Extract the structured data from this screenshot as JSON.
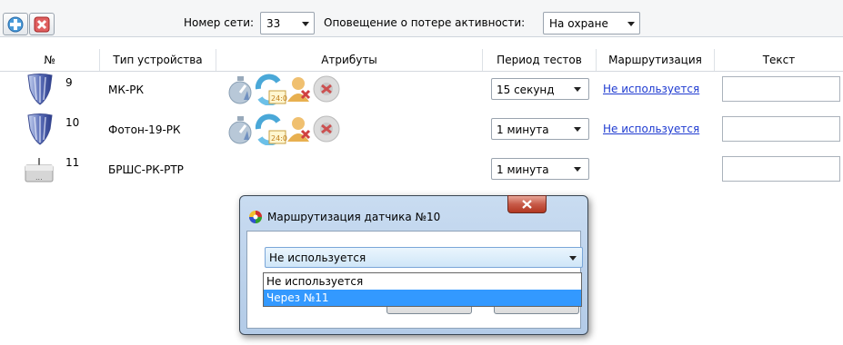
{
  "toolbar": {
    "network_label": "Номер сети:",
    "network_value": "33",
    "alert_label": "Оповещение о потере активности:",
    "alert_value": "На охране"
  },
  "table": {
    "columns": [
      "№",
      "Тип устройства",
      "Атрибуты",
      "Период тестов",
      "Маршрутизация",
      "Текст"
    ],
    "rows": [
      {
        "num": "9",
        "type": "МК-РК",
        "period": "15 секунд",
        "routing": "Не используется",
        "text": ""
      },
      {
        "num": "10",
        "type": "Фотон-19-РК",
        "period": "1 минута",
        "routing": "Не используется",
        "text": ""
      },
      {
        "num": "11",
        "type": "БРШС-РК-РТР",
        "period": "1 минута",
        "routing": "",
        "text": ""
      }
    ]
  },
  "dialog": {
    "title": "Маршрутизация датчика №10",
    "selected": "Не используется",
    "options": [
      "Не используется",
      "Через №11"
    ],
    "highlighted_option": "Через №11"
  }
}
